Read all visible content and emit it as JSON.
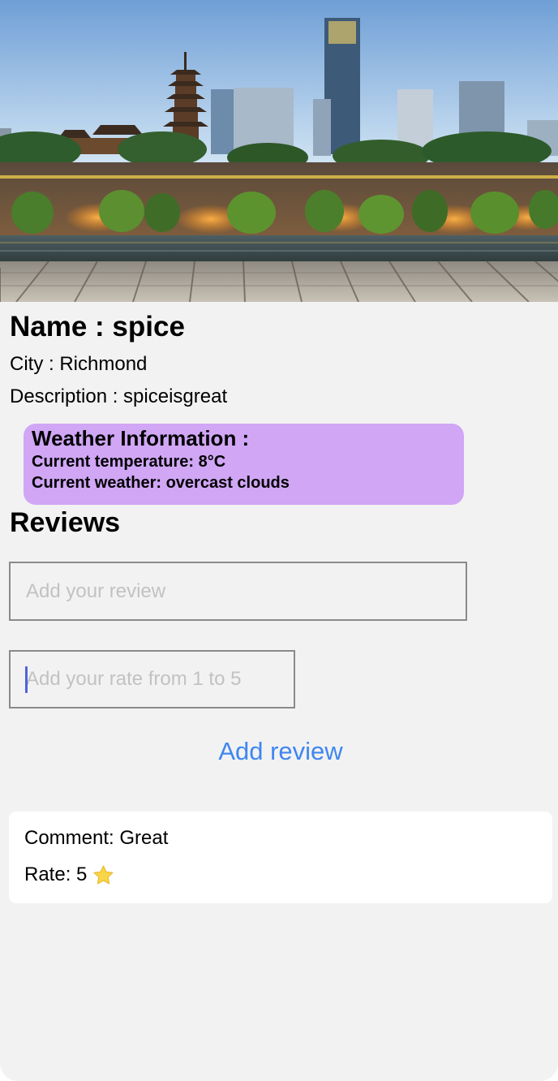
{
  "restaurant": {
    "name_line": "Name : spice",
    "city_line": "City : Richmond",
    "description_line": "Description : spiceisgreat"
  },
  "weather": {
    "title": "Weather Information :",
    "temperature_line": "Current temperature: 8°C",
    "conditions_line": "Current weather: overcast clouds",
    "card_color": "#d0a6f5"
  },
  "reviews": {
    "heading": "Reviews",
    "review_placeholder": "Add your review",
    "rate_placeholder": "Add your rate from 1 to 5",
    "add_button_label": "Add review",
    "accent_color": "#3f86f0",
    "items": [
      {
        "comment_line": "Comment: Great",
        "rate_line": "Rate: 5",
        "icon": "star-icon"
      }
    ]
  },
  "hero_image": {
    "icon": "city-skyline-photo"
  }
}
